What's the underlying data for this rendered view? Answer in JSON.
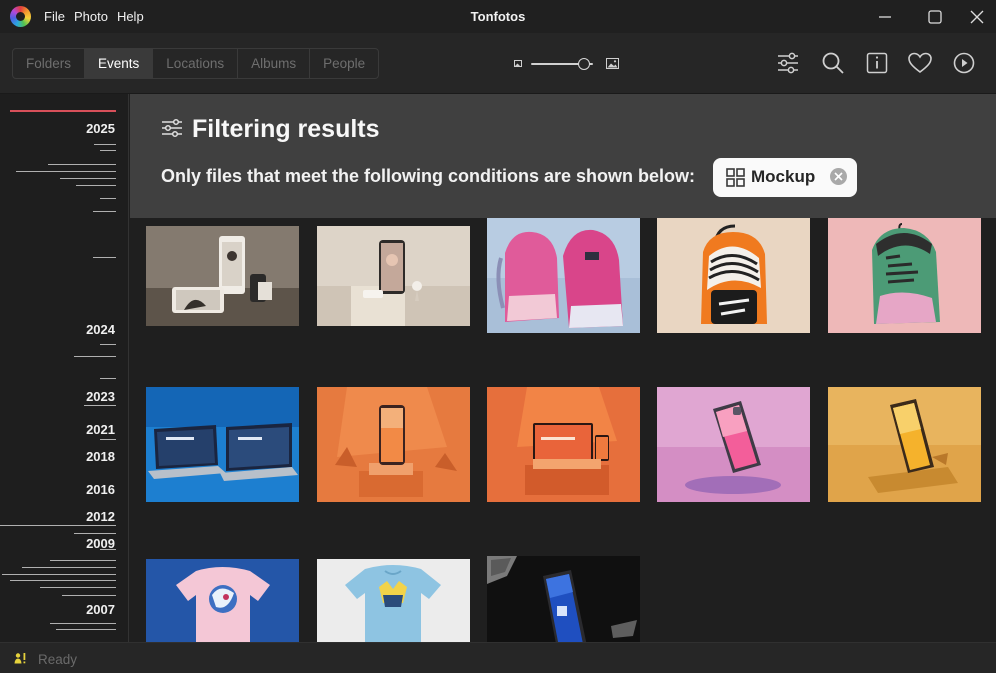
{
  "app": {
    "title": "Tonfotos",
    "menu": [
      "File",
      "Photo",
      "Help"
    ]
  },
  "toolbar": {
    "tabs": [
      {
        "label": "Folders",
        "active": false
      },
      {
        "label": "Events",
        "active": true
      },
      {
        "label": "Locations",
        "active": false
      },
      {
        "label": "Albums",
        "active": false
      },
      {
        "label": "People",
        "active": false
      }
    ],
    "zoom_level": 0.85,
    "icons": [
      "sliders-icon",
      "search-icon",
      "info-icon",
      "heart-icon",
      "play-icon"
    ]
  },
  "timeline": {
    "years": [
      "2025",
      "2024",
      "2023",
      "2021",
      "2018",
      "2016",
      "2012",
      "2009",
      "2007"
    ]
  },
  "filter": {
    "title": "Filtering results",
    "description": "Only files that meet the following conditions are shown below:",
    "chip_label": "Mockup"
  },
  "colors": {
    "accent_timeline": "#d8505a",
    "filter_bg": "#404040",
    "background": "#1f1f1f"
  },
  "status": {
    "text": "Ready"
  }
}
